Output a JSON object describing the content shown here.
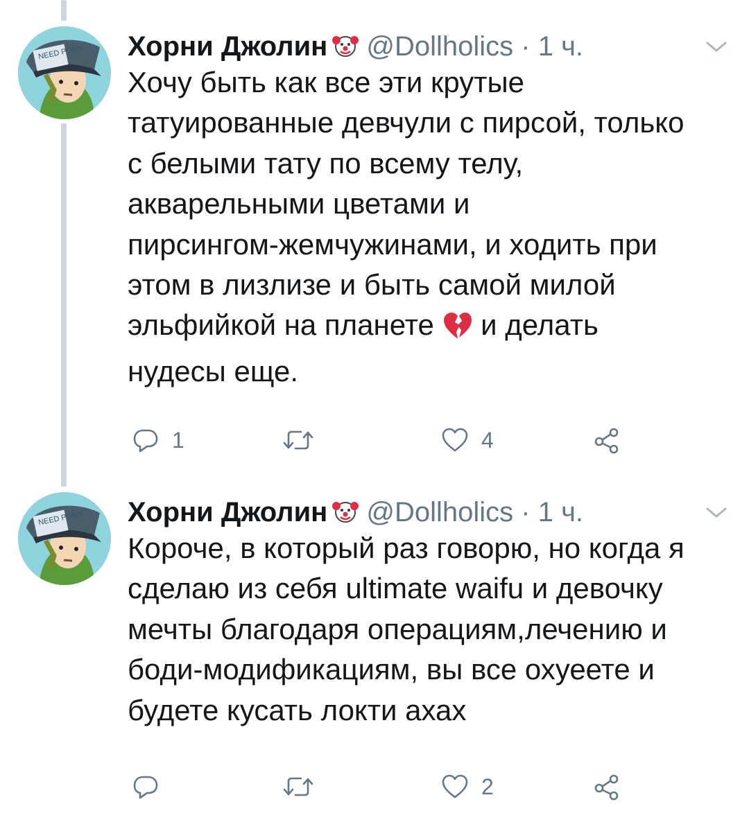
{
  "tweets": [
    {
      "author": {
        "name": "Хорни Джолин",
        "handle": "@Dollholics",
        "badge_icon": "clown-emoji-icon",
        "avatar_caption": "NEED PORN"
      },
      "separator": "·",
      "time": "1 ч.",
      "lines": [
        "Хочу быть как все эти крутые",
        "татуированные девчули с пирсой, только",
        "с белыми тату по всему телу,",
        "акварельными цветами и",
        "пирсингом-жемчужинами, и ходить при",
        "этом в лизлизе и быть самой милой",
        "эльфийкой на планете",
        "нудесы еще."
      ],
      "line7_after_emoji": "и делать",
      "inline_emoji": "broken-heart-icon",
      "replies": "1",
      "retweets": "",
      "likes": "4"
    },
    {
      "author": {
        "name": "Хорни Джолин",
        "handle": "@Dollholics",
        "badge_icon": "clown-emoji-icon",
        "avatar_caption": "NEED PORN"
      },
      "separator": "·",
      "time": "1 ч.",
      "lines": [
        "Короче, в который раз говорю, но когда я",
        "сделаю из себя ultimate waifu и девочку",
        "мечты благодаря операциям,лечению и",
        "боди-модификациям, вы все охуеете и",
        "будете кусать локти ахах"
      ],
      "replies": "",
      "retweets": "",
      "likes": "2"
    }
  ],
  "colors": {
    "text": "#14171a",
    "muted": "#657786",
    "thread_line": "#ccd6dd",
    "heart_broken": "#dd2e44"
  }
}
